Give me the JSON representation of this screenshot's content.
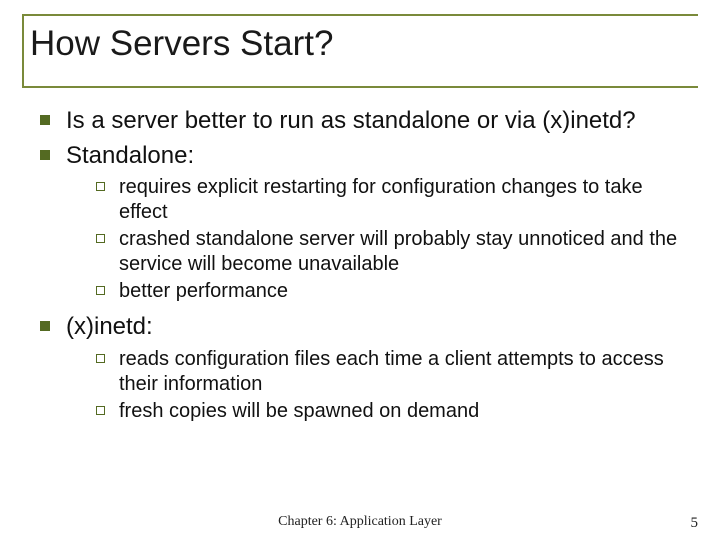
{
  "title": "How Servers Start?",
  "bullets": {
    "b1": "Is a server better to run as standalone or via (x)inetd?",
    "b2": "Standalone:",
    "b2_sub": {
      "s1": "requires explicit restarting for configuration changes to take effect",
      "s2": "crashed standalone server will probably stay unnoticed and the service will become unavailable",
      "s3": "better performance"
    },
    "b3": "(x)inetd:",
    "b3_sub": {
      "s1": "reads configuration files each time a client attempts to access their information",
      "s2": "fresh copies will be spawned on demand"
    }
  },
  "footer": "Chapter 6: Application Layer",
  "page_number": "5"
}
